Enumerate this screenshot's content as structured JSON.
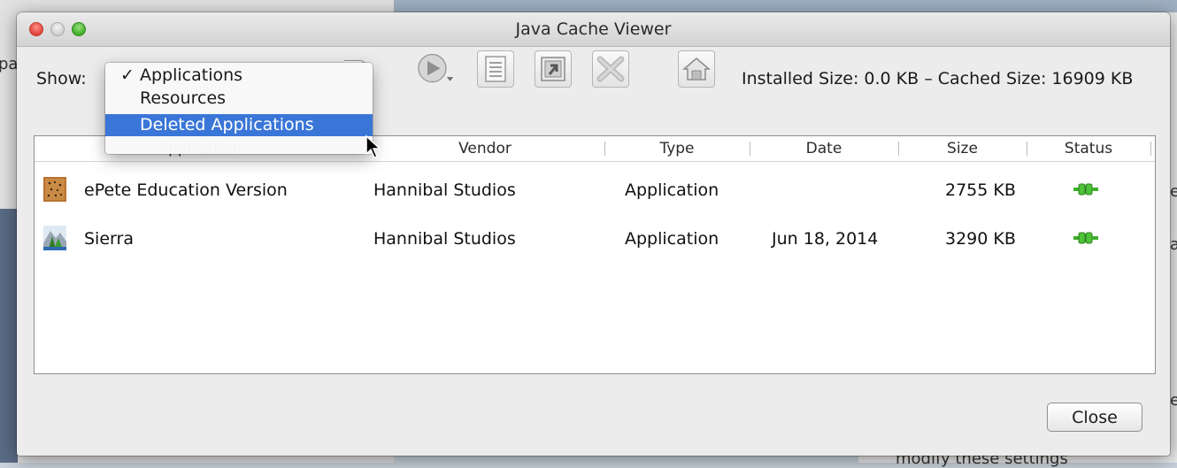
{
  "background": {
    "left_fragment": "pa",
    "right_fragment_1": "e",
    "right_fragment_2": "a",
    "right_fragment_3": "e",
    "bottom_text": "modify these settings"
  },
  "window": {
    "title": "Java Cache Viewer"
  },
  "toolbar": {
    "show_label": "Show:",
    "size_info": "Installed Size:  0.0 KB – Cached Size:  16909 KB",
    "buttons": [
      "play-icon",
      "document-icon",
      "shortcut-icon",
      "delete-icon",
      "home-icon"
    ]
  },
  "show_menu": {
    "items": [
      {
        "label": "Applications",
        "checked": true,
        "highlighted": false
      },
      {
        "label": "Resources",
        "checked": false,
        "highlighted": false
      },
      {
        "label": "Deleted Applications",
        "checked": false,
        "highlighted": true
      }
    ],
    "check_glyph": "✓"
  },
  "table": {
    "columns": [
      "Application",
      "Vendor",
      "Type",
      "Date",
      "Size",
      "Status"
    ],
    "rows": [
      {
        "application": "ePete Education Version",
        "vendor": "Hannibal Studios",
        "type": "Application",
        "date": "",
        "size": "2755 KB",
        "status": "connected-plug-icon"
      },
      {
        "application": "Sierra",
        "vendor": "Hannibal Studios",
        "type": "Application",
        "date": "Jun 18, 2014",
        "size": "3290 KB",
        "status": "connected-plug-icon"
      }
    ]
  },
  "footer": {
    "close_label": "Close"
  },
  "colors": {
    "menu_highlight": "#3a76d8",
    "status_green": "#3fae2a",
    "window_bg": "#ececec"
  }
}
